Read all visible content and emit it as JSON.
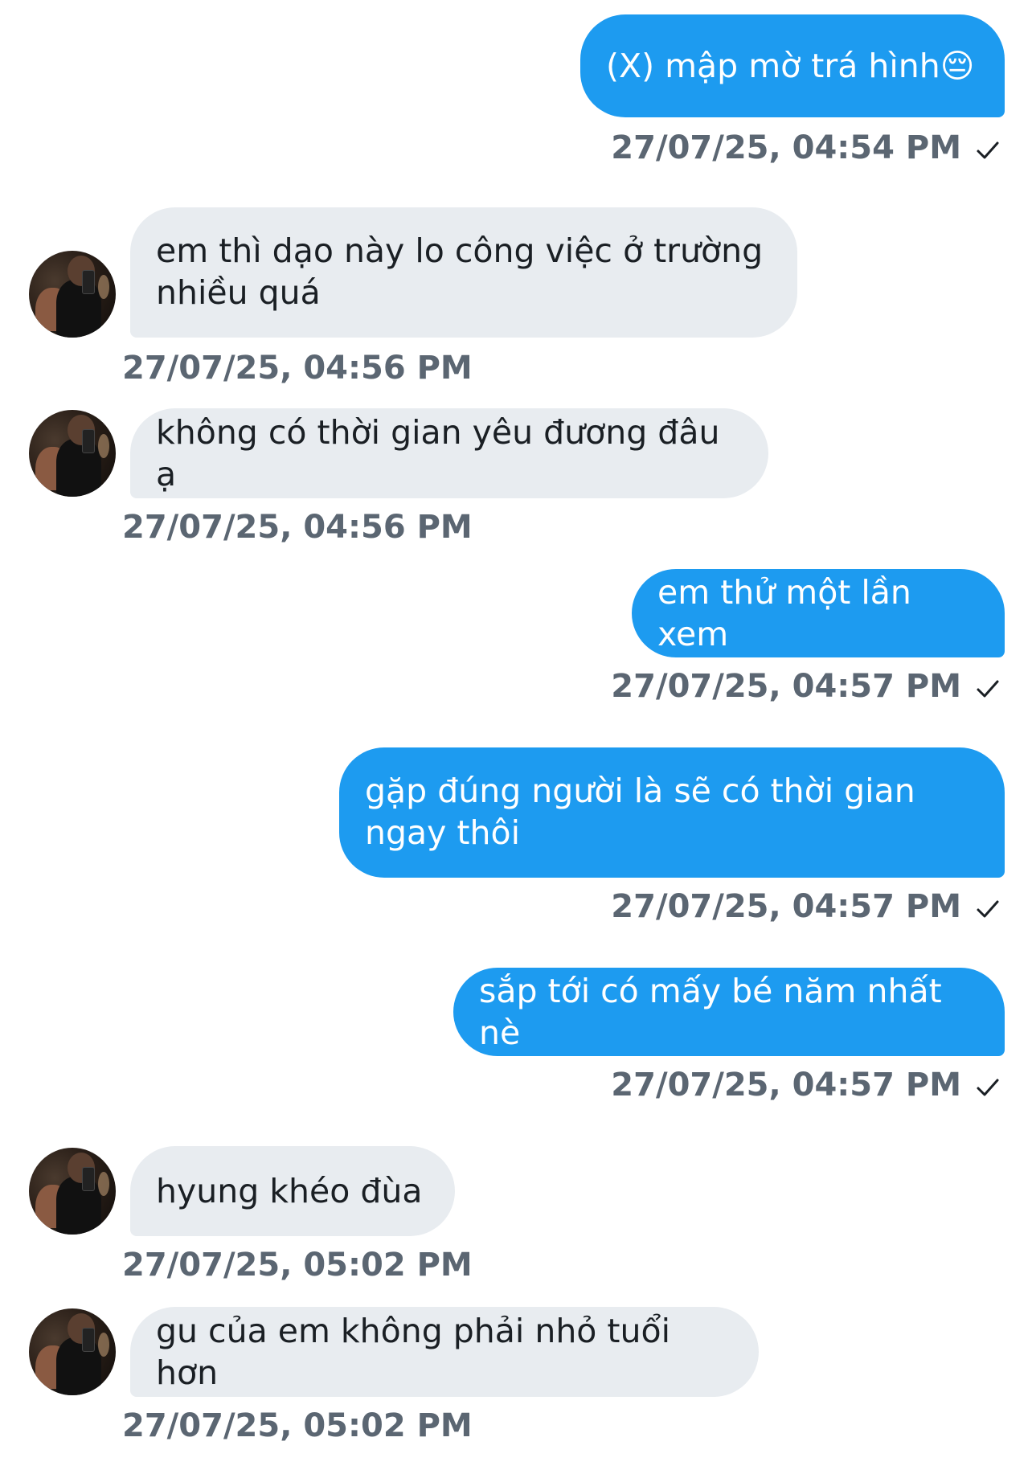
{
  "messages": [
    {
      "direction": "out",
      "text": "(X) mập mờ trá hình😔",
      "timestamp": "27/07/25, 04:54 PM",
      "status": "sent-check"
    },
    {
      "direction": "in",
      "text": "em thì dạo này lo công việc ở trường\nnhiều quá",
      "timestamp": "27/07/25, 04:56 PM"
    },
    {
      "direction": "in",
      "text": "không có thời gian yêu đương đâu ạ",
      "timestamp": "27/07/25, 04:56 PM"
    },
    {
      "direction": "out",
      "text": "em thử một lần xem",
      "timestamp": "27/07/25, 04:57 PM",
      "status": "sent-check"
    },
    {
      "direction": "out",
      "text": "gặp đúng người là sẽ có thời gian\nngay thôi",
      "timestamp": "27/07/25, 04:57 PM",
      "status": "sent-check"
    },
    {
      "direction": "out",
      "text": "sắp tới có mấy bé năm nhất nè",
      "timestamp": "27/07/25, 04:57 PM",
      "status": "sent-check"
    },
    {
      "direction": "in",
      "text": "hyung khéo đùa",
      "timestamp": "27/07/25, 05:02 PM"
    },
    {
      "direction": "in",
      "text": "gu của em không phải nhỏ tuổi hơn",
      "timestamp": "27/07/25, 05:02 PM"
    }
  ],
  "colors": {
    "outgoing_bubble": "#1d9bf0",
    "incoming_bubble": "#e8ecf0",
    "timestamp": "#5b6672"
  },
  "icons": {
    "read_status": "checkmark-icon",
    "sender_avatar": "avatar"
  }
}
